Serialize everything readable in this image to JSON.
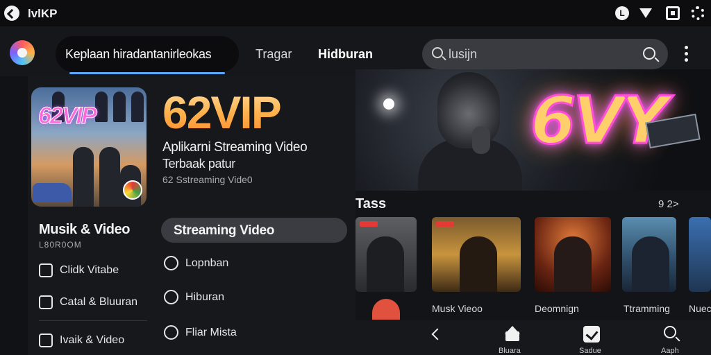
{
  "status_bar": {
    "app_name": "lvlKP",
    "badge_letter": "L"
  },
  "header": {
    "tabs": [
      {
        "label": "Keplaan hiradantanirleokas"
      },
      {
        "label": "Tragar"
      },
      {
        "label": "Hidburan"
      }
    ],
    "search": {
      "placeholder": "lusijn"
    }
  },
  "hero": {
    "neon_text": "6VY"
  },
  "promo": {
    "title": "62VIP",
    "subtitle_line1": "Aplikarni Streaming Video",
    "subtitle_line2": "Terbaak patur",
    "subtitle_line3": "62 Sstreaming Vide0",
    "poster_logo": "62VIP"
  },
  "sidebar": {
    "category_title": "Musik & Video",
    "category_sub": "L80R0OM",
    "items": [
      {
        "label": "Clidk Vitabe",
        "icon": "image-icon"
      },
      {
        "label": "Catal & Bluuran",
        "icon": "chat-icon"
      },
      {
        "label": "Ivaik & Video",
        "icon": "shield-icon"
      }
    ]
  },
  "menu": {
    "active": "Streaming Video",
    "items": [
      {
        "label": "Lopnban",
        "icon": "chat-bubble-icon"
      },
      {
        "label": "Hiburan",
        "icon": "clock-icon"
      },
      {
        "label": "Fliar Mista",
        "icon": "refresh-icon"
      }
    ]
  },
  "content": {
    "section_title": "Tass",
    "section_count": "9 2>",
    "cards": [
      {
        "caption": ""
      },
      {
        "caption": "Musk Vieoo"
      },
      {
        "caption": "Deomnign"
      },
      {
        "caption": "Ttramming"
      },
      {
        "caption": "Nuec"
      }
    ]
  },
  "bottom_nav": {
    "items": [
      {
        "label": ""
      },
      {
        "label": "Bluara"
      },
      {
        "label": "Sadue"
      },
      {
        "label": "Aaph"
      }
    ]
  },
  "colors": {
    "accent_underline": "#5aa9ff",
    "title_orange": "#ffb24d",
    "neon_pink": "#ff4fd8"
  }
}
